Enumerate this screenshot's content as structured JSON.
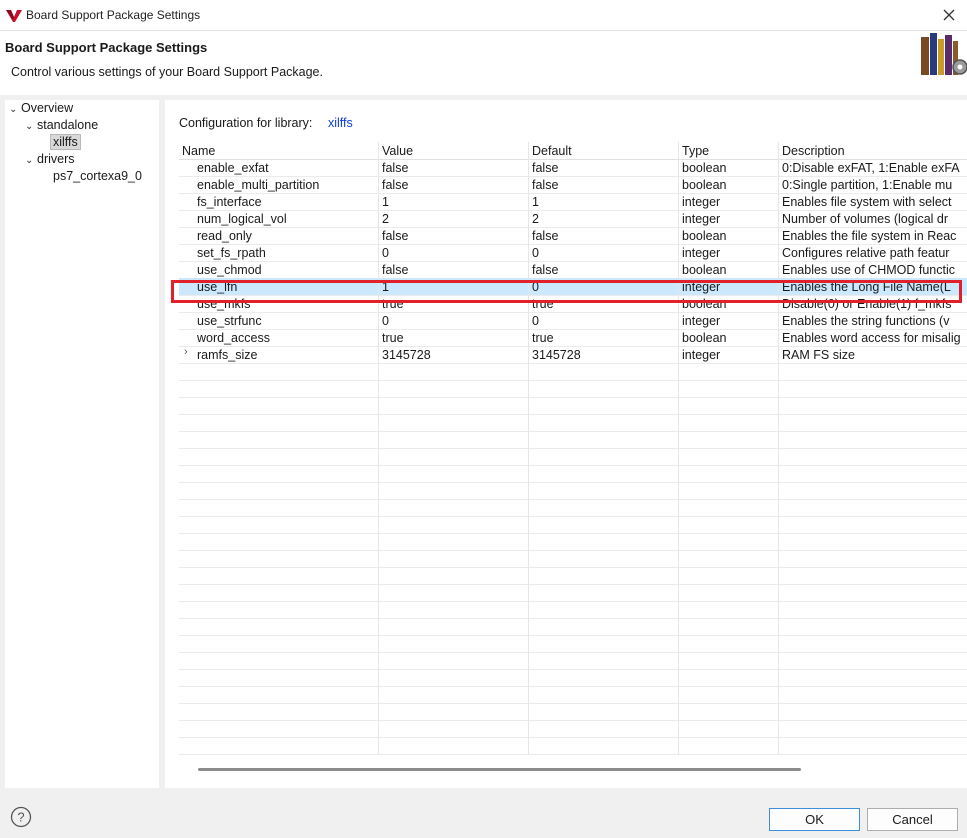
{
  "window": {
    "title": "Board Support Package Settings"
  },
  "header": {
    "title": "Board Support Package Settings",
    "description": "Control various settings of your Board Support Package."
  },
  "tree": [
    {
      "label": "Overview",
      "expanded": true,
      "depth": 0
    },
    {
      "label": "standalone",
      "expanded": true,
      "depth": 1
    },
    {
      "label": "xilffs",
      "selected": true,
      "depth": 2
    },
    {
      "label": "drivers",
      "expanded": true,
      "depth": 0
    },
    {
      "label": "ps7_cortexa9_0",
      "depth": 2
    }
  ],
  "config": {
    "label": "Configuration for library:",
    "library": "xilffs"
  },
  "table": {
    "columns": [
      "Name",
      "Value",
      "Default",
      "Type",
      "Description"
    ],
    "rows": [
      {
        "name": "enable_exfat",
        "value": "false",
        "default": "false",
        "type": "boolean",
        "description": "0:Disable exFAT, 1:Enable exFA"
      },
      {
        "name": "enable_multi_partition",
        "value": "false",
        "default": "false",
        "type": "boolean",
        "description": "0:Single partition, 1:Enable mu"
      },
      {
        "name": "fs_interface",
        "value": "1",
        "default": "1",
        "type": "integer",
        "description": "Enables file system with select"
      },
      {
        "name": "num_logical_vol",
        "value": "2",
        "default": "2",
        "type": "integer",
        "description": "Number of volumes (logical dr"
      },
      {
        "name": "read_only",
        "value": "false",
        "default": "false",
        "type": "boolean",
        "description": "Enables the file system in Reac"
      },
      {
        "name": "set_fs_rpath",
        "value": "0",
        "default": "0",
        "type": "integer",
        "description": "Configures relative path featur"
      },
      {
        "name": "use_chmod",
        "value": "false",
        "default": "false",
        "type": "boolean",
        "description": "Enables use of CHMOD functic"
      },
      {
        "name": "use_lfn",
        "value": "1",
        "default": "0",
        "type": "integer",
        "description": "Enables the Long File Name(L",
        "highlighted": true
      },
      {
        "name": "use_mkfs",
        "value": "true",
        "default": "true",
        "type": "boolean",
        "description": "Disable(0) or Enable(1) f_mkfs"
      },
      {
        "name": "use_strfunc",
        "value": "0",
        "default": "0",
        "type": "integer",
        "description": "Enables the string functions (v"
      },
      {
        "name": "word_access",
        "value": "true",
        "default": "true",
        "type": "boolean",
        "description": "Enables word access for misalig"
      },
      {
        "name": "ramfs_size",
        "value": "3145728",
        "default": "3145728",
        "type": "integer",
        "description": "RAM FS size",
        "expandable": true
      }
    ]
  },
  "buttons": {
    "ok": "OK",
    "cancel": "Cancel"
  },
  "icons": {
    "app": "vitis-logo-icon",
    "close": "close-icon",
    "header": "books-gear-icon",
    "help": "help-icon"
  },
  "colors": {
    "accent_red": "#e0202a",
    "link": "#0b3fd6",
    "selection": "#cce8ff"
  }
}
